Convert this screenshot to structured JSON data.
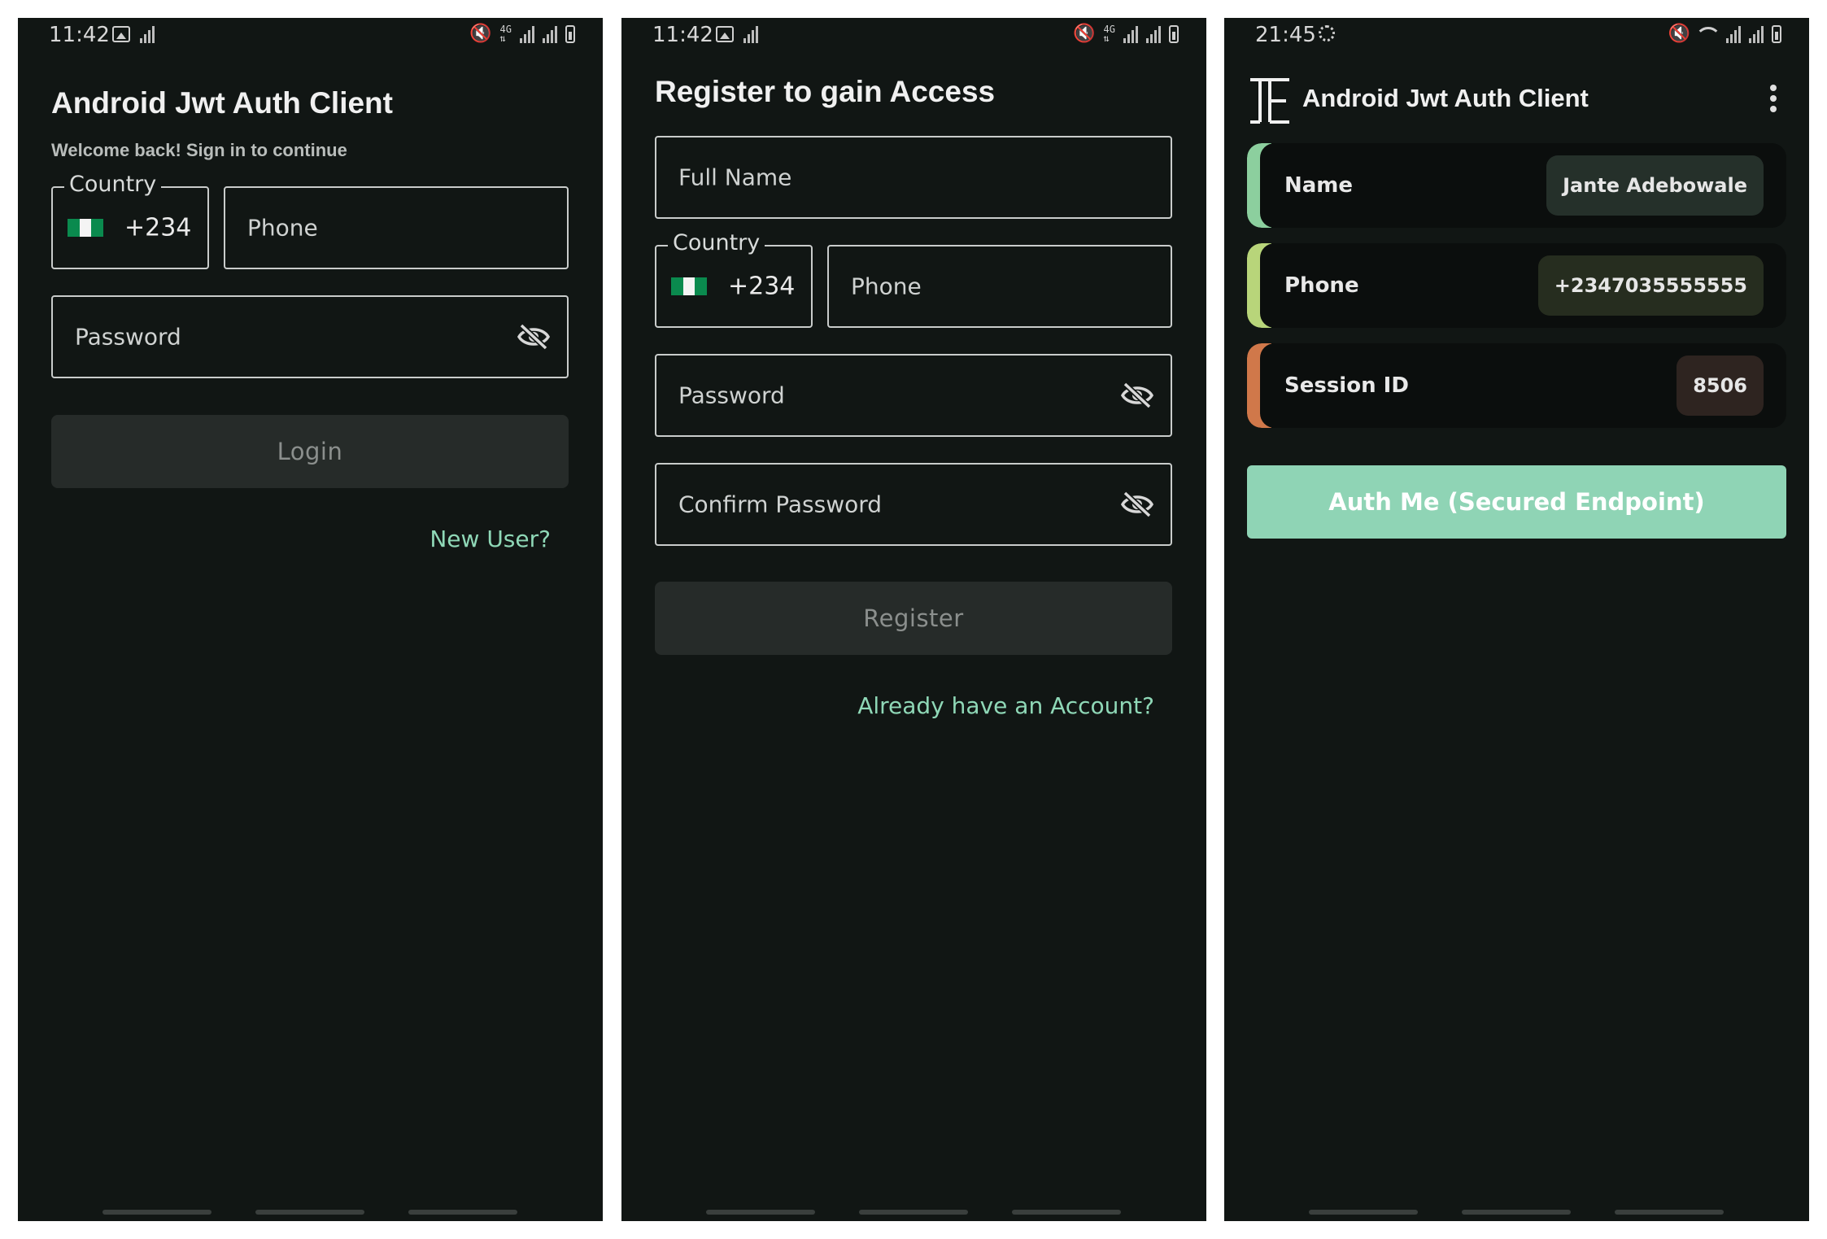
{
  "colors": {
    "background": "#111614",
    "accent_link": "#8fd8b7",
    "primary_button": "#8fd4b5",
    "disabled_button": "#262b29",
    "flag_green": "#0a8a4e",
    "name_accent": "#8ccf9e",
    "phone_accent": "#b8d57a",
    "session_accent": "#d0784a"
  },
  "login_screen": {
    "status": {
      "time": "11:42",
      "icons": [
        "image-icon",
        "signal-icon",
        "mute-icon",
        "4g-icon",
        "signal-icon",
        "signal-icon",
        "battery-icon"
      ]
    },
    "title": "Android Jwt Auth Client",
    "subtitle": "Welcome back! Sign in to continue",
    "country_label": "Country",
    "country_code": "+234",
    "phone_placeholder": "Phone",
    "password_placeholder": "Password",
    "login_button": "Login",
    "new_user_link": "New User?"
  },
  "register_screen": {
    "status": {
      "time": "11:42",
      "icons": [
        "image-icon",
        "signal-icon",
        "mute-icon",
        "4g-icon",
        "signal-icon",
        "signal-icon",
        "battery-icon"
      ]
    },
    "title": "Register to gain Access",
    "full_name_placeholder": "Full Name",
    "country_label": "Country",
    "country_code": "+234",
    "phone_placeholder": "Phone",
    "password_placeholder": "Password",
    "confirm_password_placeholder": "Confirm Password",
    "register_button": "Register",
    "login_link": "Already have an Account?"
  },
  "profile_screen": {
    "status": {
      "time": "21:45",
      "icons": [
        "settings-icon",
        "mute-icon",
        "wifi-icon",
        "signal-icon",
        "signal-icon",
        "battery-icon"
      ]
    },
    "app_title": "Android Jwt Auth Client",
    "rows": [
      {
        "label": "Name",
        "value": "Jante Adebowale"
      },
      {
        "label": "Phone",
        "value": "+2347035555555"
      },
      {
        "label": "Session ID",
        "value": "8506"
      }
    ],
    "auth_button": "Auth Me (Secured Endpoint)"
  }
}
